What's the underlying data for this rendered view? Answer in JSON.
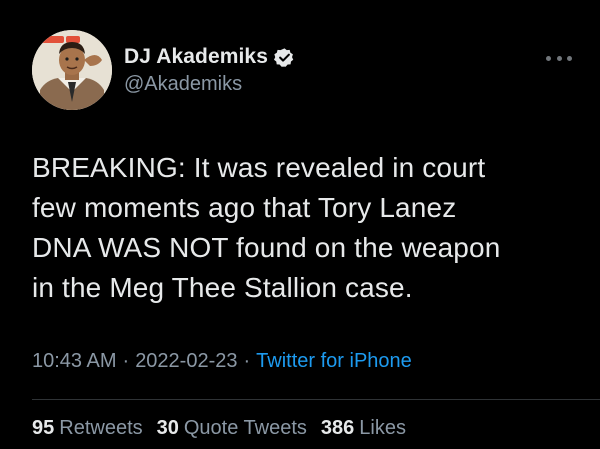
{
  "author": {
    "display_name": "DJ Akademiks",
    "handle": "@Akademiks",
    "verified": true,
    "avatar_icon": "profile-photo"
  },
  "menu_icon": "more-horizontal-icon",
  "tweet": {
    "lines": [
      "BREAKING: It was revealed in court",
      "few moments ago that Tory Lanez",
      "DNA WAS NOT found on the weapon",
      "in the Meg Thee Stallion case."
    ]
  },
  "meta": {
    "time": "10:43 AM",
    "separator": "·",
    "date": "2022-02-23",
    "source": "Twitter for iPhone"
  },
  "stats": {
    "retweets_count": "95",
    "retweets_label": "Retweets",
    "quotes_count": "30",
    "quotes_label": "Quote Tweets",
    "likes_count": "386",
    "likes_label": "Likes"
  },
  "colors": {
    "background": "#000000",
    "text_primary": "#e7e9ea",
    "text_secondary": "#8b98a5",
    "link": "#1d9bf0",
    "divider": "#2f3336"
  }
}
